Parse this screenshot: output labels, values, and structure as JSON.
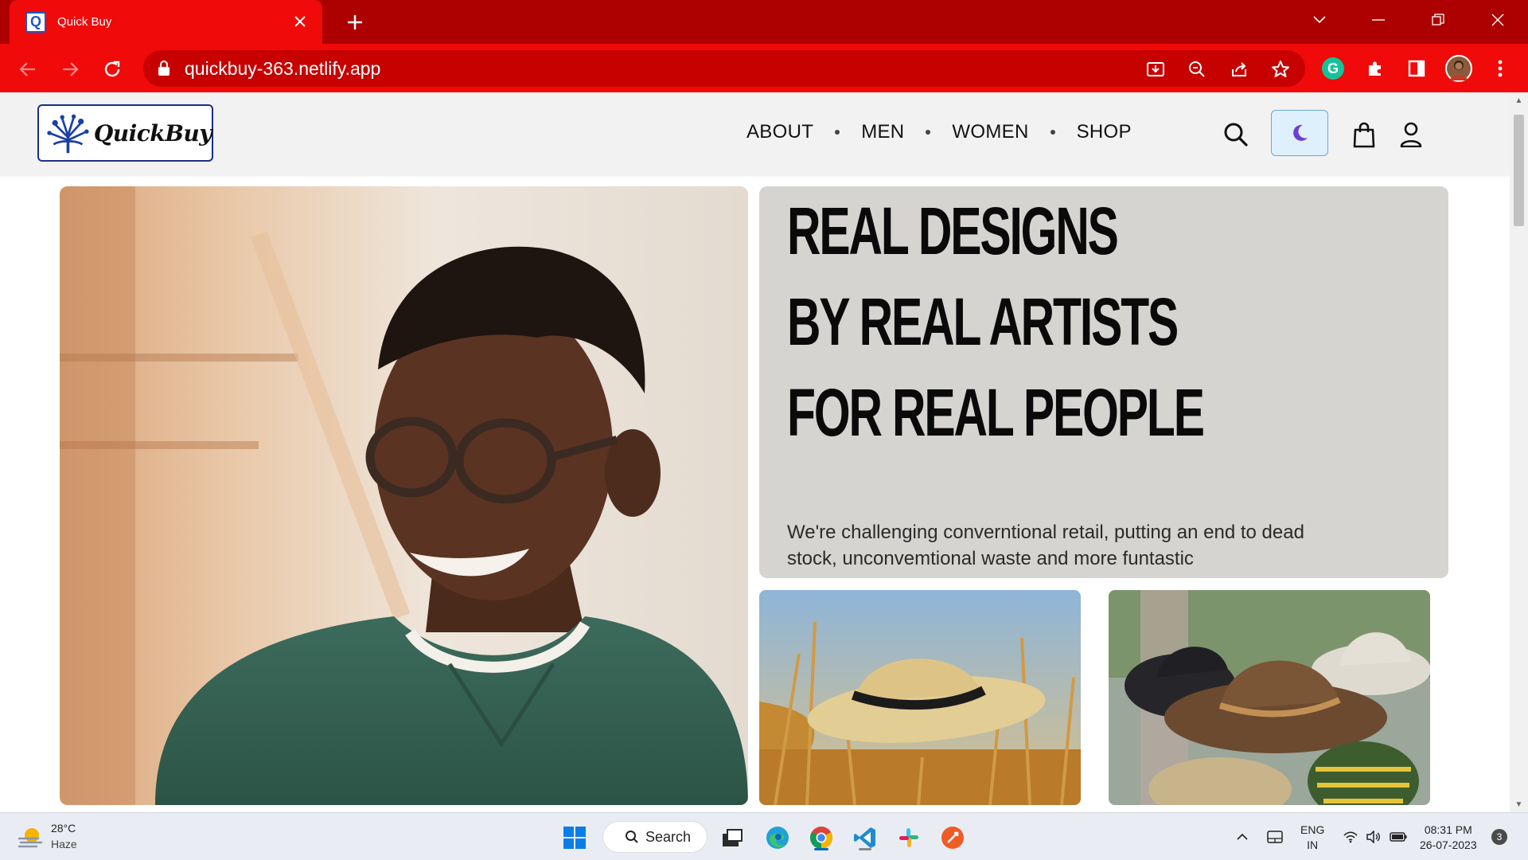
{
  "browser": {
    "tab": {
      "title": "Quick Buy",
      "favicon_letter": "Q"
    },
    "url": "quickbuy-363.netlify.app",
    "theme_color": "#f00a0a"
  },
  "site": {
    "logo_text": "QuickBuy",
    "nav": [
      "ABOUT",
      "MEN",
      "WOMEN",
      "SHOP"
    ],
    "header_icons": [
      "search-icon",
      "moon-icon",
      "shopping-bag-icon",
      "user-icon"
    ],
    "hero": {
      "headline": [
        "REAL DESIGNS",
        "BY REAL ARTISTS",
        "FOR REAL PEOPLE"
      ],
      "tagline": "We're challenging converntional retail, putting an end to dead stock, unconvemtional waste and more funtastic"
    }
  },
  "taskbar": {
    "weather": {
      "temp": "28°C",
      "desc": "Haze"
    },
    "search_label": "Search",
    "lang": [
      "ENG",
      "IN"
    ],
    "time": "08:31 PM",
    "date": "26-07-2023",
    "notifications": "3"
  }
}
